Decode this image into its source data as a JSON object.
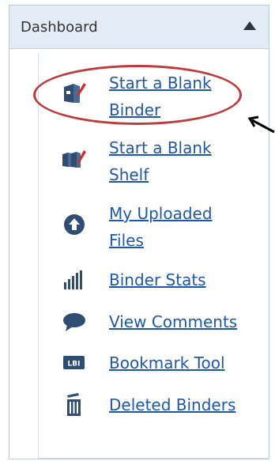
{
  "panel": {
    "title": "Dashboard",
    "collapse_icon": "triangle-up-icon"
  },
  "items": [
    {
      "label_line1": "Start a Blank",
      "label_line2": "Binder",
      "icon": "binder-icon"
    },
    {
      "label_line1": "Start a Blank",
      "label_line2": "Shelf",
      "icon": "shelf-icon"
    },
    {
      "label_line1": "My Uploaded",
      "label_line2": "Files",
      "icon": "upload-icon"
    },
    {
      "label_line1": "Binder Stats",
      "icon": "stats-icon"
    },
    {
      "label_line1": "View Comments",
      "icon": "comment-icon"
    },
    {
      "label_line1": "Bookmark Tool",
      "icon": "bookmark-tool-icon",
      "icon_text": "LBI"
    },
    {
      "label_line1": "Deleted Binders",
      "icon": "trash-icon"
    }
  ],
  "colors": {
    "link": "#1f58a8",
    "highlight_oval": "#bf3b3b",
    "icon": "#2f4c73"
  }
}
